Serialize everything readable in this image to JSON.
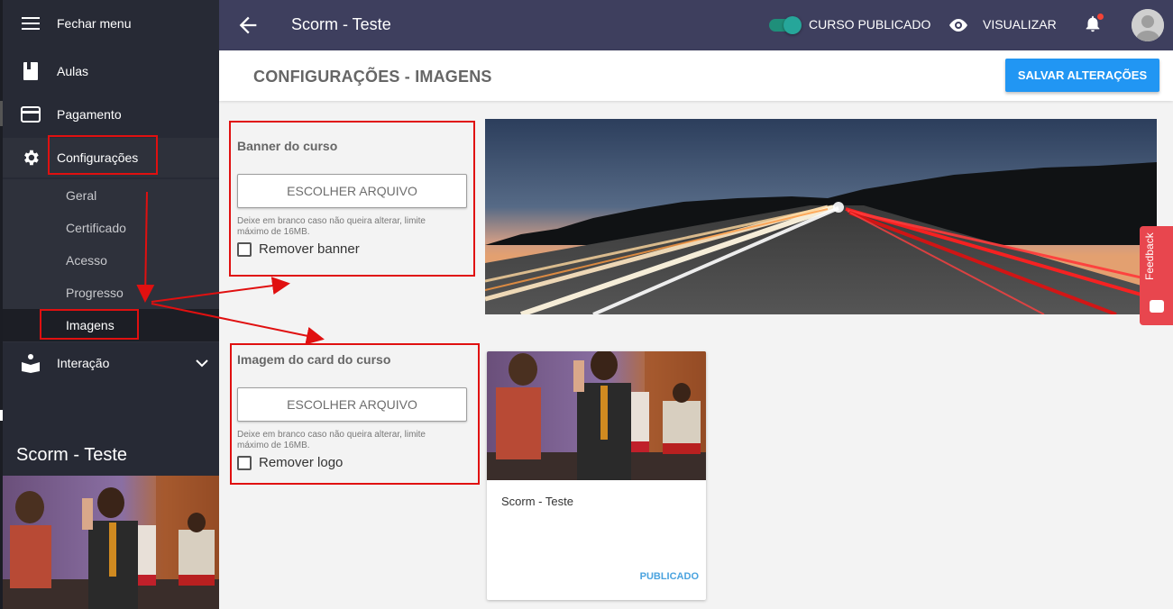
{
  "sidebar": {
    "close_menu_label": "Fechar menu",
    "items": [
      {
        "label": "Aulas",
        "icon": "book-icon"
      },
      {
        "label": "Pagamento",
        "icon": "credit-card-icon"
      },
      {
        "label": "Configurações",
        "icon": "gear-icon"
      },
      {
        "label": "Interação",
        "icon": "reader-icon"
      }
    ],
    "subitems": [
      {
        "label": "Geral"
      },
      {
        "label": "Certificado"
      },
      {
        "label": "Acesso"
      },
      {
        "label": "Progresso"
      },
      {
        "label": "Imagens",
        "selected": true
      }
    ],
    "course_title": "Scorm - Teste"
  },
  "topbar": {
    "title": "Scorm - Teste",
    "published_label": "CURSO PUBLICADO",
    "published": true,
    "view_label": "VISUALIZAR"
  },
  "page": {
    "title": "CONFIGURAÇÕES - IMAGENS",
    "save_label": "SALVAR ALTERAÇÕES"
  },
  "banner_section": {
    "title": "Banner do curso",
    "file_button": "ESCOLHER ARQUIVO",
    "hint": "Deixe em branco caso não queira alterar, limite máximo de 16MB.",
    "remove_label": "Remover banner"
  },
  "card_section": {
    "title": "Imagem do card do curso",
    "file_button": "ESCOLHER ARQUIVO",
    "hint": "Deixe em branco caso não queira alterar, limite máximo de 16MB.",
    "remove_label": "Remover logo"
  },
  "card_preview": {
    "title": "Scorm - Teste",
    "status": "PUBLICADO"
  },
  "feedback_label": "Feedback",
  "colors": {
    "sidebar": "#272a35",
    "topbar": "#3e3f5e",
    "accent": "#2196f3",
    "annotation": "#e01010",
    "toggle": "#26a69a",
    "feedback": "#e8464e"
  }
}
